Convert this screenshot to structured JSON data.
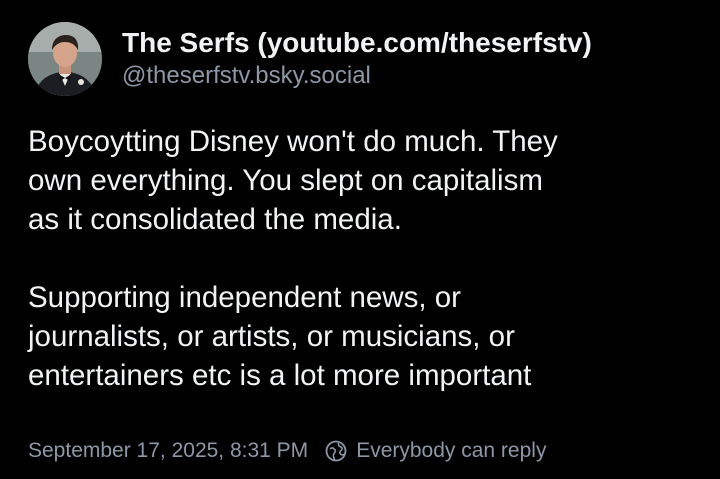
{
  "author": {
    "display_name": "The Serfs (youtube.com/theserfstv)",
    "handle": "@theserfstv.bsky.social",
    "avatar_icon": "profile-photo"
  },
  "post": {
    "paragraph1_lines": [
      "Boycoytting Disney won't do much. They",
      "own everything. You slept on capitalism",
      "as it consolidated the media."
    ],
    "paragraph2_lines": [
      "Supporting independent news, or",
      "journalists, or artists, or musicians, or",
      "entertainers etc is a lot more important"
    ]
  },
  "meta": {
    "timestamp": "September 17, 2025, 8:31 PM",
    "reply_icon": "globe-reply-icon",
    "reply_setting": "Everybody can reply"
  },
  "colors": {
    "background": "#000000",
    "text": "#f1f3f5",
    "muted": "#8d97a6"
  }
}
